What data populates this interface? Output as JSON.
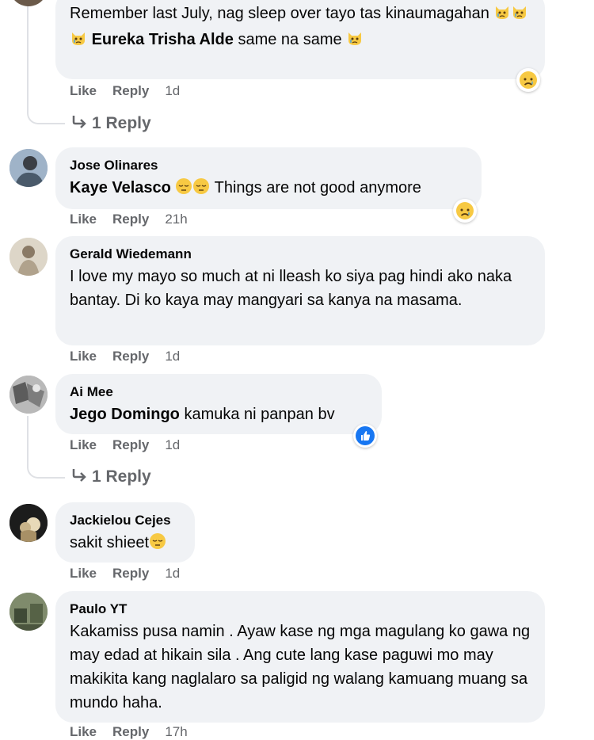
{
  "comments": [
    {
      "author": "",
      "text_before": "Remember last July, nag sleep over tayo tas kinaumagahan ",
      "mention": "Eureka Trisha Alde",
      "text_after": " same na same",
      "like": "Like",
      "reply": "Reply",
      "time": "1d",
      "reaction": "sad-face-icon",
      "replies_label": "1 Reply"
    },
    {
      "author": "Jose Olinares",
      "mention": "Kaye Velasco",
      "text_after": " Things are not good anymore",
      "like": "Like",
      "reply": "Reply",
      "time": "21h",
      "reaction": "sad-face-icon"
    },
    {
      "author": "Gerald Wiedemann",
      "text": "I love my mayo so much at ni lleash ko siya pag hindi ako naka bantay. Di ko kaya may mangyari sa kanya na masama.",
      "like": "Like",
      "reply": "Reply",
      "time": "1d"
    },
    {
      "author": "Ai Mee",
      "mention": "Jego Domingo",
      "text_after": " kamuka ni panpan bv",
      "like": "Like",
      "reply": "Reply",
      "time": "1d",
      "reaction": "like-thumb-icon",
      "replies_label": "1 Reply"
    },
    {
      "author": "Jackielou Cejes",
      "text": "sakit shieet",
      "like": "Like",
      "reply": "Reply",
      "time": "1d"
    },
    {
      "author": "Paulo YT",
      "text": "Kakamiss pusa namin . Ayaw kase ng mga magulang ko gawa ng may edad at hikain sila . Ang cute lang kase paguwi mo may makikita kang naglalaro sa paligid ng walang kamuang muang sa mundo haha.",
      "like": "Like",
      "reply": "Reply",
      "time": "17h"
    }
  ],
  "colors": {
    "bubble": "#f0f2f5",
    "meta_text": "#65676b",
    "like_blue": "#1877f2",
    "emoji_yellow": "#f7c943"
  }
}
